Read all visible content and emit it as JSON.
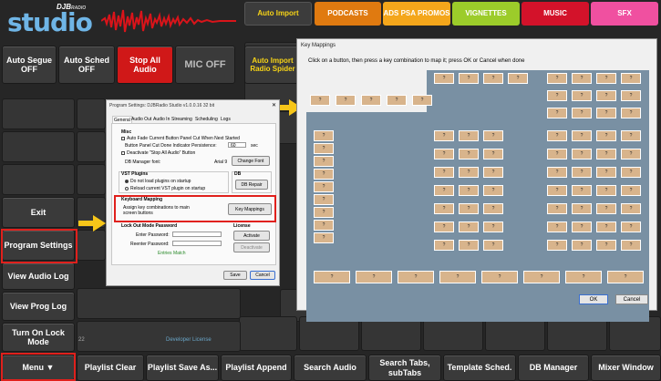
{
  "logo": {
    "brand": "DJB",
    "radio": "RADIO",
    "name": "studio"
  },
  "categories": [
    {
      "label": "Auto Import",
      "bg": "#3c3c3c",
      "fg": "#f7d417"
    },
    {
      "label": "PODCASTS",
      "bg": "#e07a10",
      "fg": "#ffffff"
    },
    {
      "label": "ADS PSA PROMOS",
      "bg": "#f4a61b",
      "fg": "#ffffff"
    },
    {
      "label": "VIGNETTES",
      "bg": "#9ccc2a",
      "fg": "#ffffff"
    },
    {
      "label": "MUSIC",
      "bg": "#d3122a",
      "fg": "#ffffff"
    },
    {
      "label": "SFX",
      "bg": "#f050a0",
      "fg": "#ffffff"
    }
  ],
  "controls": {
    "auto_segue": "Auto Segue OFF",
    "auto_sched": "Auto Sched OFF",
    "stop_all": "Stop All Audio",
    "mic": "MIC OFF",
    "auto_import_spider": "Auto Import Radio Spider"
  },
  "side_menu": {
    "exit": "Exit",
    "program_settings": "Program Settings",
    "view_audio_log": "View Audio Log",
    "view_prog_log": "View Prog Log",
    "turn_on_lock": "Turn On Lock Mode",
    "menu": "Menu ▼"
  },
  "status": {
    "version_frag": "22",
    "license": "Developer License"
  },
  "bottom_bar": [
    "Playlist Clear",
    "Playlist Save As...",
    "Playlist Append",
    "Search Audio",
    "Search Tabs, subTabs",
    "Template Sched.",
    "DB Manager",
    "Mixer Window"
  ],
  "program_settings": {
    "title": "Program Settings: DJBRadio Studio v1.0.0.16 32 bit",
    "tabs": [
      "General",
      "Audio Out",
      "Audio In",
      "Streaming",
      "Scheduling",
      "Logs"
    ],
    "misc_title": "Misc",
    "auto_fade": "Auto Fade Current Button Panel Cut When Next Started",
    "persistence_label": "Button Panel Cut Done Indicator Persistence:",
    "persistence_value": "60",
    "persistence_unit": "sec",
    "deactivate_stop": "Deactivate \"Stop All Audio\" Button",
    "font_label": "DB Manager font:",
    "font_value": "Arial 9",
    "change_font": "Change Font",
    "vst_title": "VST Plugins",
    "vst_opt1": "Do not load plugins on startup",
    "vst_opt2": "Reload current VST plugin on startup",
    "db_title": "DB",
    "db_repair": "DB Repair",
    "km_title": "Keyboard Mapping",
    "km_desc": "Assign key combinations to main screen buttons",
    "km_button": "Key Mappings",
    "lock_title": "Lock Out Mode Password",
    "enter_pw": "Enter Password:",
    "reenter_pw": "Reenter Password:",
    "match": "Entries Match",
    "license_title": "License",
    "activate": "Activate",
    "deactivate": "Deactivate",
    "save": "Save",
    "cancel": "Cancel"
  },
  "key_mappings": {
    "title": "Key Mappings",
    "instructions": "Click on a button, then press a key combination to map it; press OK or Cancel when done",
    "key_label": "?",
    "ok": "OK",
    "cancel": "Cancel"
  }
}
